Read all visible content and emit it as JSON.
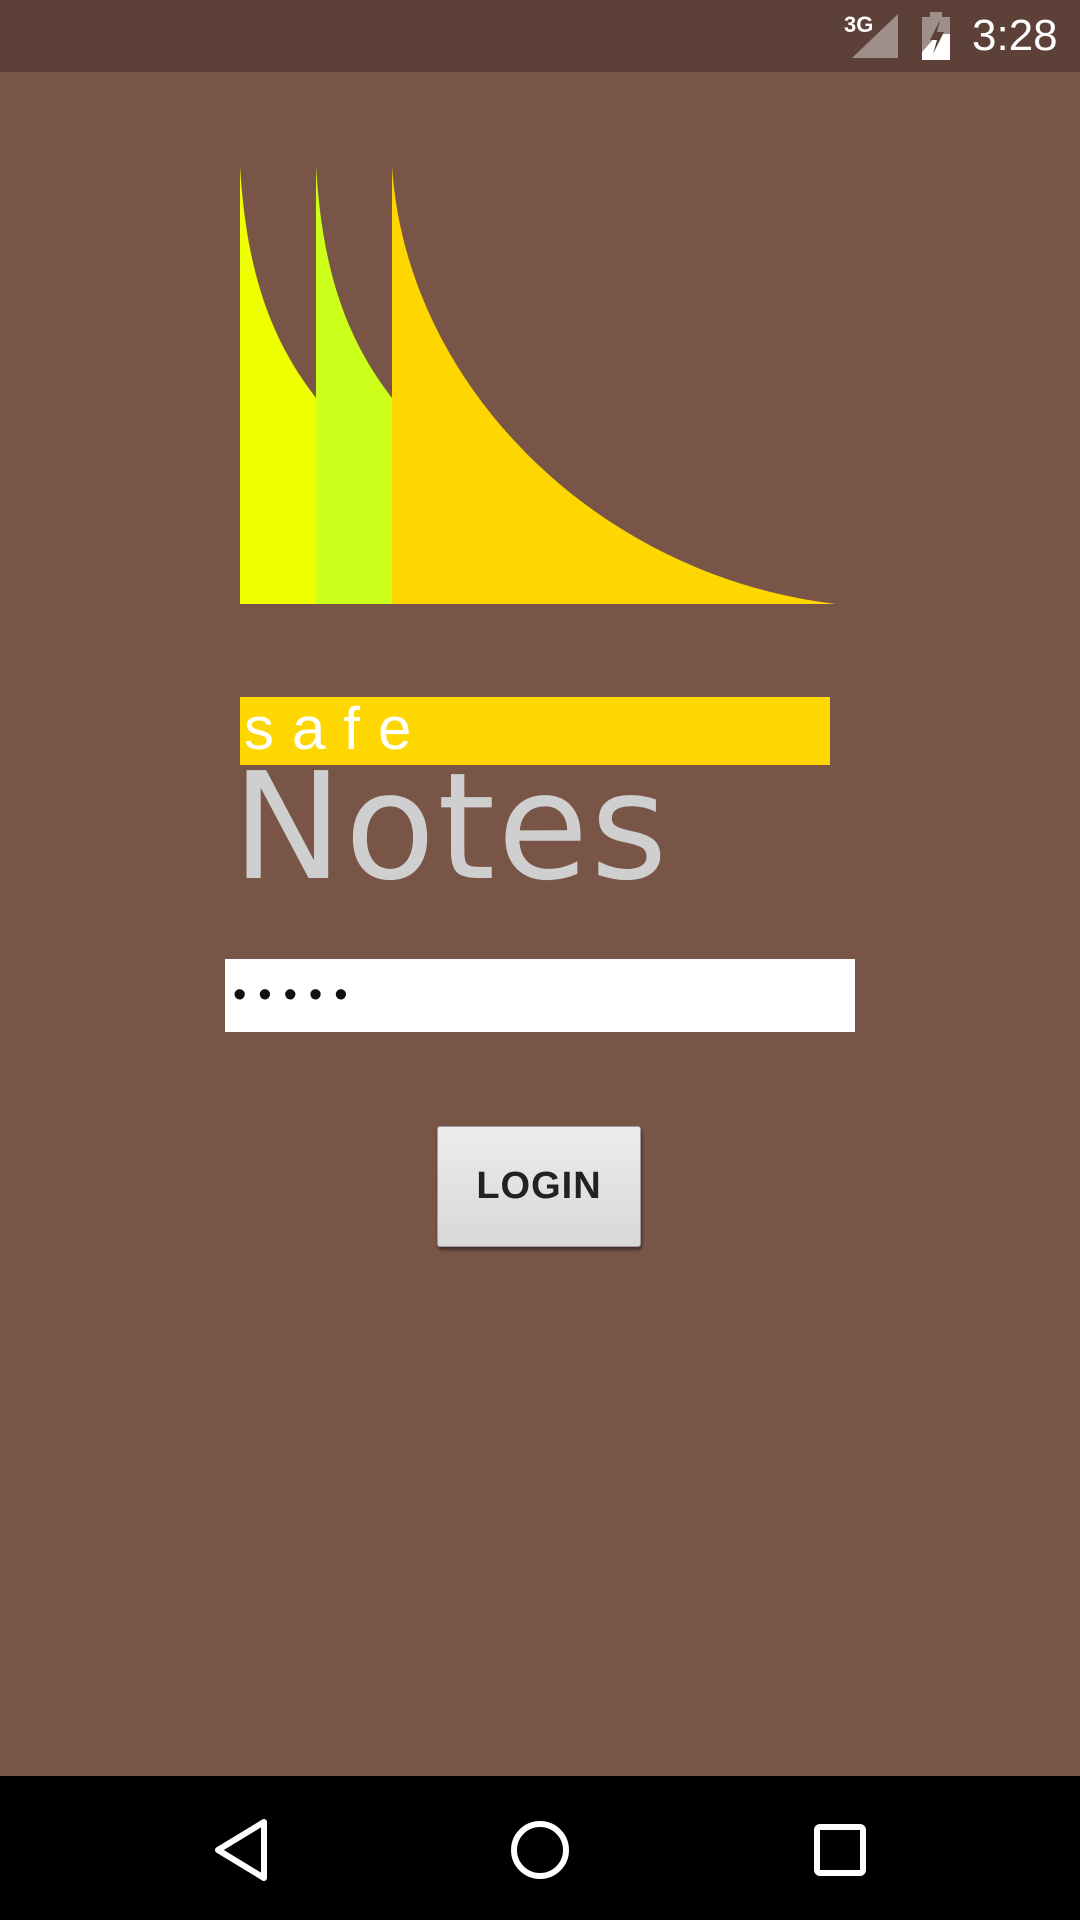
{
  "status_bar": {
    "network": "3G",
    "time": "3:28",
    "icons": [
      "signal-icon",
      "battery-charging-icon"
    ]
  },
  "logo": {
    "line1": "safe",
    "line2": "Notes",
    "colors": {
      "stripe1": "#EEFF00",
      "stripe2": "#CCFF1A",
      "stripe3": "#FFD700",
      "bar": "#FFD700",
      "notes_text": "#CFCFCF"
    }
  },
  "login": {
    "password_value": "•••••",
    "button_label": "LOGIN"
  },
  "nav_bar": {
    "icons": [
      "back-icon",
      "home-icon",
      "recents-icon"
    ]
  },
  "colors": {
    "background": "#795548",
    "status_bar": "#5D4037",
    "nav_bar": "#000000"
  }
}
